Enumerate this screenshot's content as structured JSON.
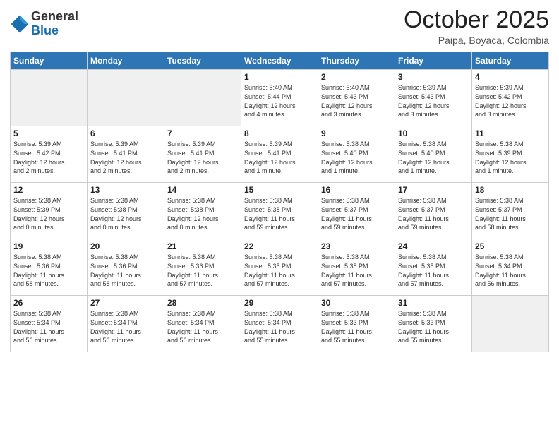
{
  "header": {
    "logo_general": "General",
    "logo_blue": "Blue",
    "month": "October 2025",
    "location": "Paipa, Boyaca, Colombia"
  },
  "weekdays": [
    "Sunday",
    "Monday",
    "Tuesday",
    "Wednesday",
    "Thursday",
    "Friday",
    "Saturday"
  ],
  "weeks": [
    [
      {
        "day": "",
        "text": ""
      },
      {
        "day": "",
        "text": ""
      },
      {
        "day": "",
        "text": ""
      },
      {
        "day": "1",
        "text": "Sunrise: 5:40 AM\nSunset: 5:44 PM\nDaylight: 12 hours\nand 4 minutes."
      },
      {
        "day": "2",
        "text": "Sunrise: 5:40 AM\nSunset: 5:43 PM\nDaylight: 12 hours\nand 3 minutes."
      },
      {
        "day": "3",
        "text": "Sunrise: 5:39 AM\nSunset: 5:43 PM\nDaylight: 12 hours\nand 3 minutes."
      },
      {
        "day": "4",
        "text": "Sunrise: 5:39 AM\nSunset: 5:42 PM\nDaylight: 12 hours\nand 3 minutes."
      }
    ],
    [
      {
        "day": "5",
        "text": "Sunrise: 5:39 AM\nSunset: 5:42 PM\nDaylight: 12 hours\nand 2 minutes."
      },
      {
        "day": "6",
        "text": "Sunrise: 5:39 AM\nSunset: 5:41 PM\nDaylight: 12 hours\nand 2 minutes."
      },
      {
        "day": "7",
        "text": "Sunrise: 5:39 AM\nSunset: 5:41 PM\nDaylight: 12 hours\nand 2 minutes."
      },
      {
        "day": "8",
        "text": "Sunrise: 5:39 AM\nSunset: 5:41 PM\nDaylight: 12 hours\nand 1 minute."
      },
      {
        "day": "9",
        "text": "Sunrise: 5:38 AM\nSunset: 5:40 PM\nDaylight: 12 hours\nand 1 minute."
      },
      {
        "day": "10",
        "text": "Sunrise: 5:38 AM\nSunset: 5:40 PM\nDaylight: 12 hours\nand 1 minute."
      },
      {
        "day": "11",
        "text": "Sunrise: 5:38 AM\nSunset: 5:39 PM\nDaylight: 12 hours\nand 1 minute."
      }
    ],
    [
      {
        "day": "12",
        "text": "Sunrise: 5:38 AM\nSunset: 5:39 PM\nDaylight: 12 hours\nand 0 minutes."
      },
      {
        "day": "13",
        "text": "Sunrise: 5:38 AM\nSunset: 5:38 PM\nDaylight: 12 hours\nand 0 minutes."
      },
      {
        "day": "14",
        "text": "Sunrise: 5:38 AM\nSunset: 5:38 PM\nDaylight: 12 hours\nand 0 minutes."
      },
      {
        "day": "15",
        "text": "Sunrise: 5:38 AM\nSunset: 5:38 PM\nDaylight: 11 hours\nand 59 minutes."
      },
      {
        "day": "16",
        "text": "Sunrise: 5:38 AM\nSunset: 5:37 PM\nDaylight: 11 hours\nand 59 minutes."
      },
      {
        "day": "17",
        "text": "Sunrise: 5:38 AM\nSunset: 5:37 PM\nDaylight: 11 hours\nand 59 minutes."
      },
      {
        "day": "18",
        "text": "Sunrise: 5:38 AM\nSunset: 5:37 PM\nDaylight: 11 hours\nand 58 minutes."
      }
    ],
    [
      {
        "day": "19",
        "text": "Sunrise: 5:38 AM\nSunset: 5:36 PM\nDaylight: 11 hours\nand 58 minutes."
      },
      {
        "day": "20",
        "text": "Sunrise: 5:38 AM\nSunset: 5:36 PM\nDaylight: 11 hours\nand 58 minutes."
      },
      {
        "day": "21",
        "text": "Sunrise: 5:38 AM\nSunset: 5:36 PM\nDaylight: 11 hours\nand 57 minutes."
      },
      {
        "day": "22",
        "text": "Sunrise: 5:38 AM\nSunset: 5:35 PM\nDaylight: 11 hours\nand 57 minutes."
      },
      {
        "day": "23",
        "text": "Sunrise: 5:38 AM\nSunset: 5:35 PM\nDaylight: 11 hours\nand 57 minutes."
      },
      {
        "day": "24",
        "text": "Sunrise: 5:38 AM\nSunset: 5:35 PM\nDaylight: 11 hours\nand 57 minutes."
      },
      {
        "day": "25",
        "text": "Sunrise: 5:38 AM\nSunset: 5:34 PM\nDaylight: 11 hours\nand 56 minutes."
      }
    ],
    [
      {
        "day": "26",
        "text": "Sunrise: 5:38 AM\nSunset: 5:34 PM\nDaylight: 11 hours\nand 56 minutes."
      },
      {
        "day": "27",
        "text": "Sunrise: 5:38 AM\nSunset: 5:34 PM\nDaylight: 11 hours\nand 56 minutes."
      },
      {
        "day": "28",
        "text": "Sunrise: 5:38 AM\nSunset: 5:34 PM\nDaylight: 11 hours\nand 56 minutes."
      },
      {
        "day": "29",
        "text": "Sunrise: 5:38 AM\nSunset: 5:34 PM\nDaylight: 11 hours\nand 55 minutes."
      },
      {
        "day": "30",
        "text": "Sunrise: 5:38 AM\nSunset: 5:33 PM\nDaylight: 11 hours\nand 55 minutes."
      },
      {
        "day": "31",
        "text": "Sunrise: 5:38 AM\nSunset: 5:33 PM\nDaylight: 11 hours\nand 55 minutes."
      },
      {
        "day": "",
        "text": ""
      }
    ]
  ]
}
